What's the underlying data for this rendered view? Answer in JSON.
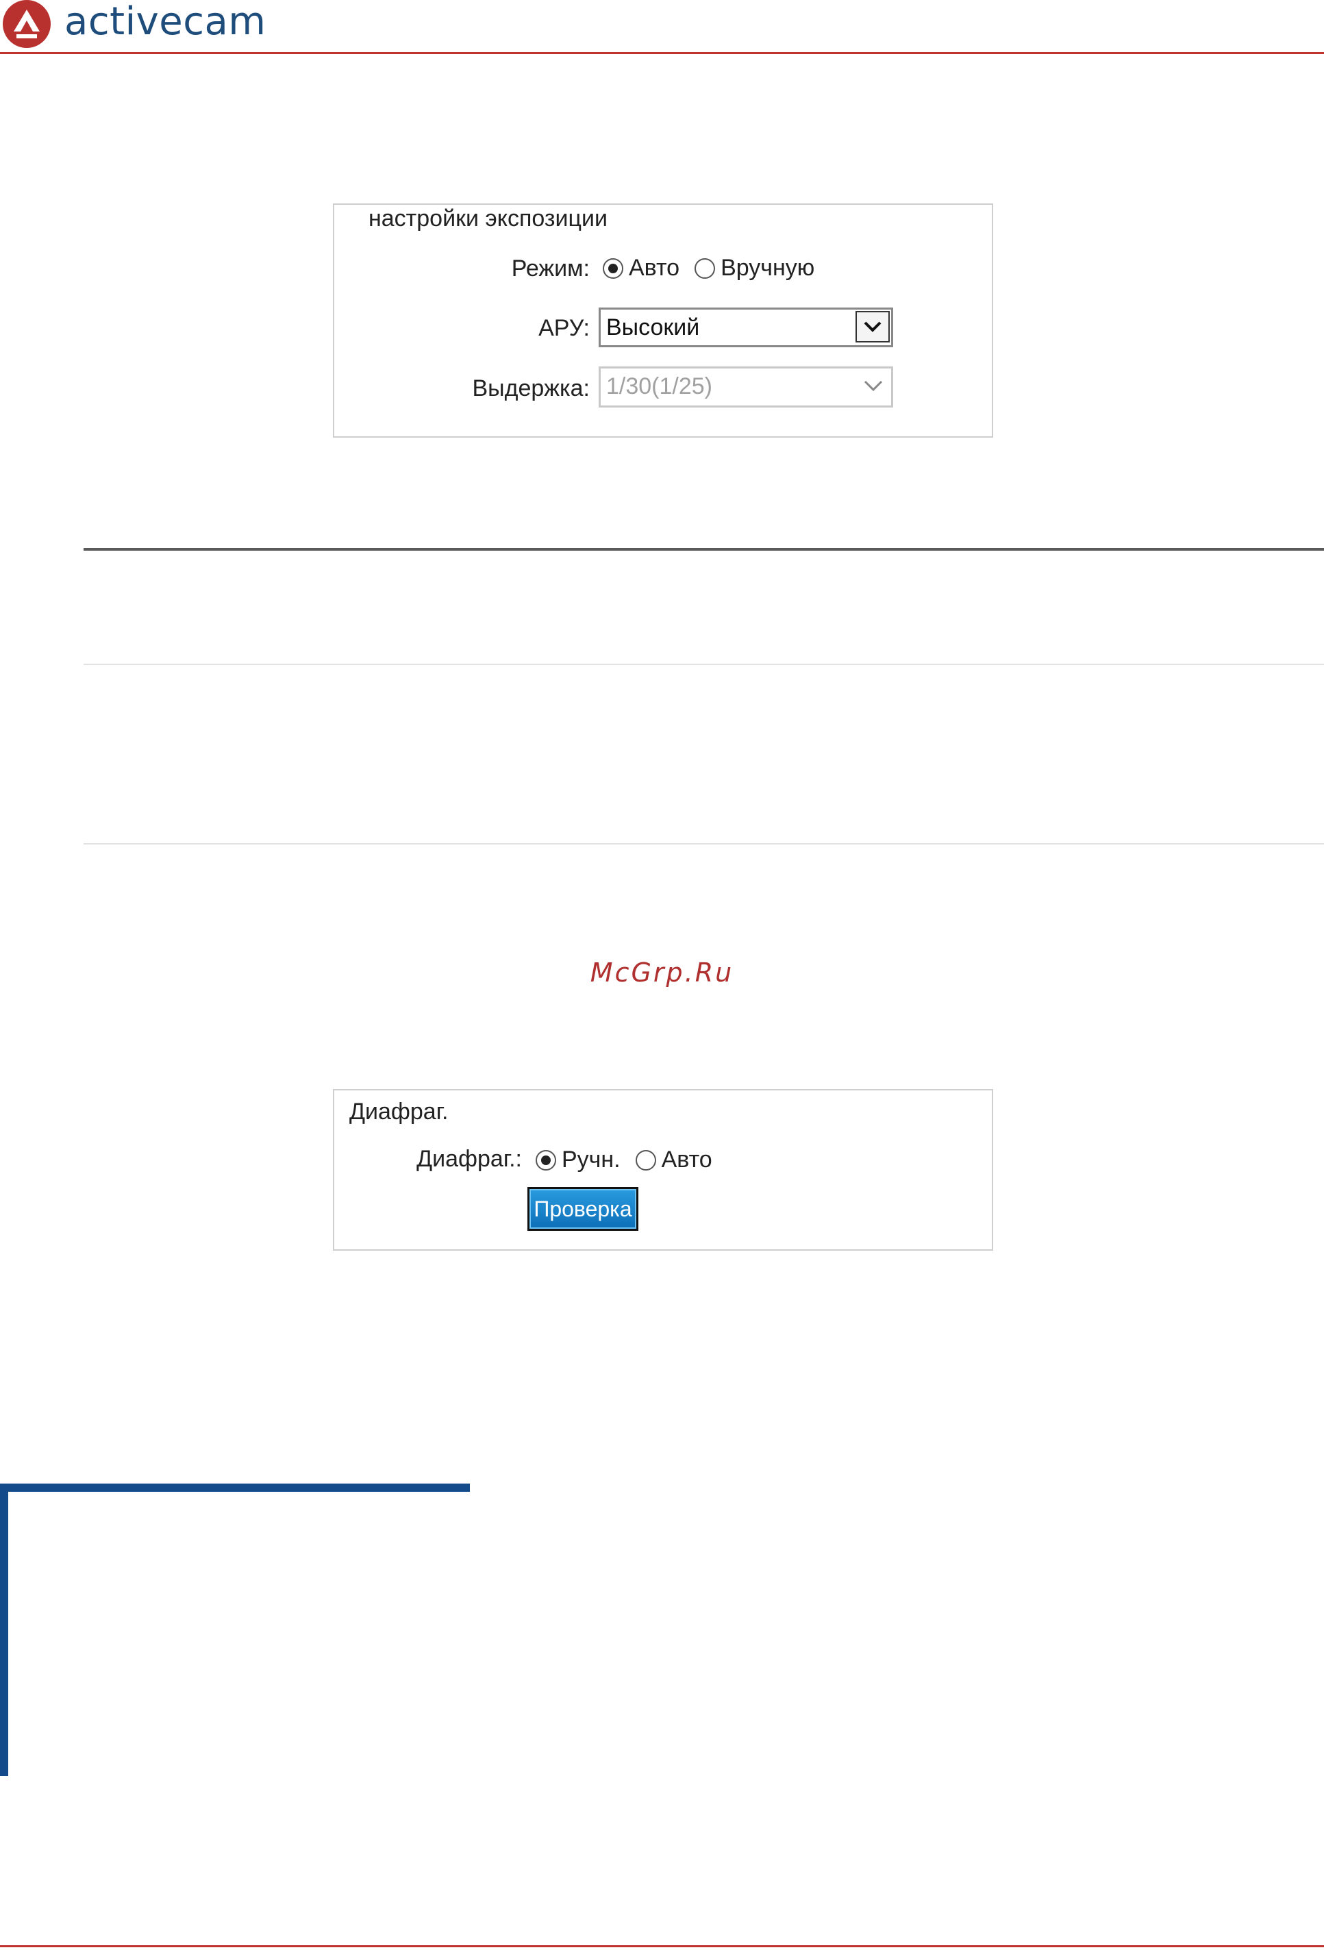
{
  "header": {
    "brand": "activecam"
  },
  "colors": {
    "brand_red": "#c0322f",
    "brand_blue": "#1e4d7b",
    "bracket_blue": "#134a8a",
    "button_blue": "#0d6fb8"
  },
  "exposure": {
    "legend": "настройки экспозиции",
    "mode": {
      "label": "Режим:",
      "options": [
        "Авто",
        "Вручную"
      ],
      "selected": "Авто"
    },
    "agc": {
      "label": "АРУ:",
      "value": "Высокий"
    },
    "shutter": {
      "label": "Выдержка:",
      "value": "1/30(1/25)"
    }
  },
  "watermark": "McGrp.Ru",
  "iris": {
    "legend": "Диафраг.",
    "mode": {
      "label": "Диафраг.:",
      "options": [
        "Ручн.",
        "Авто"
      ],
      "selected": "Ручн."
    },
    "test_button": "Проверка"
  },
  "icons": {
    "logo": "activecam-logo-icon",
    "select_arrow": "chevron-down-icon"
  }
}
